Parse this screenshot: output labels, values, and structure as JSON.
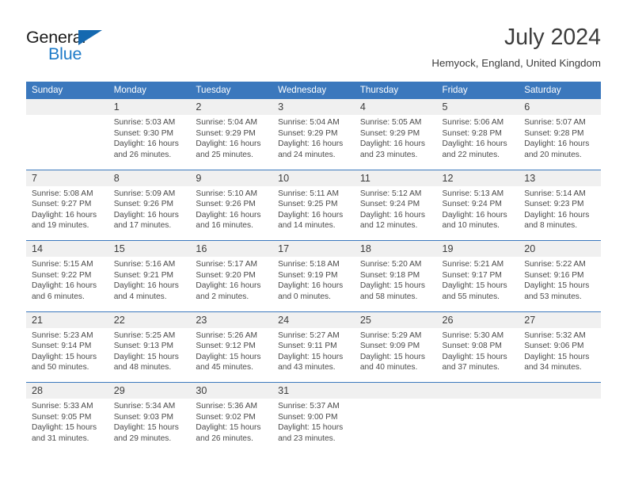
{
  "brand": {
    "name_top": "General",
    "name_bottom": "Blue",
    "accent_color": "#1e7bc8",
    "triangle_color": "#1569b0"
  },
  "header": {
    "month_year": "July 2024",
    "location": "Hemyock, England, United Kingdom"
  },
  "theme": {
    "header_blue": "#3b78bd",
    "daynum_band": "#f0f0f0",
    "text": "#3c3c3c"
  },
  "calendar": {
    "weekday_headers": [
      "Sunday",
      "Monday",
      "Tuesday",
      "Wednesday",
      "Thursday",
      "Friday",
      "Saturday"
    ],
    "weeks": [
      [
        {
          "day": "",
          "sunrise": "",
          "sunset": "",
          "daylight_line1": "",
          "daylight_line2": "",
          "empty": true
        },
        {
          "day": "1",
          "sunrise": "Sunrise: 5:03 AM",
          "sunset": "Sunset: 9:30 PM",
          "daylight_line1": "Daylight: 16 hours",
          "daylight_line2": "and 26 minutes."
        },
        {
          "day": "2",
          "sunrise": "Sunrise: 5:04 AM",
          "sunset": "Sunset: 9:29 PM",
          "daylight_line1": "Daylight: 16 hours",
          "daylight_line2": "and 25 minutes."
        },
        {
          "day": "3",
          "sunrise": "Sunrise: 5:04 AM",
          "sunset": "Sunset: 9:29 PM",
          "daylight_line1": "Daylight: 16 hours",
          "daylight_line2": "and 24 minutes."
        },
        {
          "day": "4",
          "sunrise": "Sunrise: 5:05 AM",
          "sunset": "Sunset: 9:29 PM",
          "daylight_line1": "Daylight: 16 hours",
          "daylight_line2": "and 23 minutes."
        },
        {
          "day": "5",
          "sunrise": "Sunrise: 5:06 AM",
          "sunset": "Sunset: 9:28 PM",
          "daylight_line1": "Daylight: 16 hours",
          "daylight_line2": "and 22 minutes."
        },
        {
          "day": "6",
          "sunrise": "Sunrise: 5:07 AM",
          "sunset": "Sunset: 9:28 PM",
          "daylight_line1": "Daylight: 16 hours",
          "daylight_line2": "and 20 minutes."
        }
      ],
      [
        {
          "day": "7",
          "sunrise": "Sunrise: 5:08 AM",
          "sunset": "Sunset: 9:27 PM",
          "daylight_line1": "Daylight: 16 hours",
          "daylight_line2": "and 19 minutes."
        },
        {
          "day": "8",
          "sunrise": "Sunrise: 5:09 AM",
          "sunset": "Sunset: 9:26 PM",
          "daylight_line1": "Daylight: 16 hours",
          "daylight_line2": "and 17 minutes."
        },
        {
          "day": "9",
          "sunrise": "Sunrise: 5:10 AM",
          "sunset": "Sunset: 9:26 PM",
          "daylight_line1": "Daylight: 16 hours",
          "daylight_line2": "and 16 minutes."
        },
        {
          "day": "10",
          "sunrise": "Sunrise: 5:11 AM",
          "sunset": "Sunset: 9:25 PM",
          "daylight_line1": "Daylight: 16 hours",
          "daylight_line2": "and 14 minutes."
        },
        {
          "day": "11",
          "sunrise": "Sunrise: 5:12 AM",
          "sunset": "Sunset: 9:24 PM",
          "daylight_line1": "Daylight: 16 hours",
          "daylight_line2": "and 12 minutes."
        },
        {
          "day": "12",
          "sunrise": "Sunrise: 5:13 AM",
          "sunset": "Sunset: 9:24 PM",
          "daylight_line1": "Daylight: 16 hours",
          "daylight_line2": "and 10 minutes."
        },
        {
          "day": "13",
          "sunrise": "Sunrise: 5:14 AM",
          "sunset": "Sunset: 9:23 PM",
          "daylight_line1": "Daylight: 16 hours",
          "daylight_line2": "and 8 minutes."
        }
      ],
      [
        {
          "day": "14",
          "sunrise": "Sunrise: 5:15 AM",
          "sunset": "Sunset: 9:22 PM",
          "daylight_line1": "Daylight: 16 hours",
          "daylight_line2": "and 6 minutes."
        },
        {
          "day": "15",
          "sunrise": "Sunrise: 5:16 AM",
          "sunset": "Sunset: 9:21 PM",
          "daylight_line1": "Daylight: 16 hours",
          "daylight_line2": "and 4 minutes."
        },
        {
          "day": "16",
          "sunrise": "Sunrise: 5:17 AM",
          "sunset": "Sunset: 9:20 PM",
          "daylight_line1": "Daylight: 16 hours",
          "daylight_line2": "and 2 minutes."
        },
        {
          "day": "17",
          "sunrise": "Sunrise: 5:18 AM",
          "sunset": "Sunset: 9:19 PM",
          "daylight_line1": "Daylight: 16 hours",
          "daylight_line2": "and 0 minutes."
        },
        {
          "day": "18",
          "sunrise": "Sunrise: 5:20 AM",
          "sunset": "Sunset: 9:18 PM",
          "daylight_line1": "Daylight: 15 hours",
          "daylight_line2": "and 58 minutes."
        },
        {
          "day": "19",
          "sunrise": "Sunrise: 5:21 AM",
          "sunset": "Sunset: 9:17 PM",
          "daylight_line1": "Daylight: 15 hours",
          "daylight_line2": "and 55 minutes."
        },
        {
          "day": "20",
          "sunrise": "Sunrise: 5:22 AM",
          "sunset": "Sunset: 9:16 PM",
          "daylight_line1": "Daylight: 15 hours",
          "daylight_line2": "and 53 minutes."
        }
      ],
      [
        {
          "day": "21",
          "sunrise": "Sunrise: 5:23 AM",
          "sunset": "Sunset: 9:14 PM",
          "daylight_line1": "Daylight: 15 hours",
          "daylight_line2": "and 50 minutes."
        },
        {
          "day": "22",
          "sunrise": "Sunrise: 5:25 AM",
          "sunset": "Sunset: 9:13 PM",
          "daylight_line1": "Daylight: 15 hours",
          "daylight_line2": "and 48 minutes."
        },
        {
          "day": "23",
          "sunrise": "Sunrise: 5:26 AM",
          "sunset": "Sunset: 9:12 PM",
          "daylight_line1": "Daylight: 15 hours",
          "daylight_line2": "and 45 minutes."
        },
        {
          "day": "24",
          "sunrise": "Sunrise: 5:27 AM",
          "sunset": "Sunset: 9:11 PM",
          "daylight_line1": "Daylight: 15 hours",
          "daylight_line2": "and 43 minutes."
        },
        {
          "day": "25",
          "sunrise": "Sunrise: 5:29 AM",
          "sunset": "Sunset: 9:09 PM",
          "daylight_line1": "Daylight: 15 hours",
          "daylight_line2": "and 40 minutes."
        },
        {
          "day": "26",
          "sunrise": "Sunrise: 5:30 AM",
          "sunset": "Sunset: 9:08 PM",
          "daylight_line1": "Daylight: 15 hours",
          "daylight_line2": "and 37 minutes."
        },
        {
          "day": "27",
          "sunrise": "Sunrise: 5:32 AM",
          "sunset": "Sunset: 9:06 PM",
          "daylight_line1": "Daylight: 15 hours",
          "daylight_line2": "and 34 minutes."
        }
      ],
      [
        {
          "day": "28",
          "sunrise": "Sunrise: 5:33 AM",
          "sunset": "Sunset: 9:05 PM",
          "daylight_line1": "Daylight: 15 hours",
          "daylight_line2": "and 31 minutes."
        },
        {
          "day": "29",
          "sunrise": "Sunrise: 5:34 AM",
          "sunset": "Sunset: 9:03 PM",
          "daylight_line1": "Daylight: 15 hours",
          "daylight_line2": "and 29 minutes."
        },
        {
          "day": "30",
          "sunrise": "Sunrise: 5:36 AM",
          "sunset": "Sunset: 9:02 PM",
          "daylight_line1": "Daylight: 15 hours",
          "daylight_line2": "and 26 minutes."
        },
        {
          "day": "31",
          "sunrise": "Sunrise: 5:37 AM",
          "sunset": "Sunset: 9:00 PM",
          "daylight_line1": "Daylight: 15 hours",
          "daylight_line2": "and 23 minutes."
        },
        {
          "day": "",
          "sunrise": "",
          "sunset": "",
          "daylight_line1": "",
          "daylight_line2": "",
          "empty": true
        },
        {
          "day": "",
          "sunrise": "",
          "sunset": "",
          "daylight_line1": "",
          "daylight_line2": "",
          "empty": true
        },
        {
          "day": "",
          "sunrise": "",
          "sunset": "",
          "daylight_line1": "",
          "daylight_line2": "",
          "empty": true
        }
      ]
    ]
  }
}
